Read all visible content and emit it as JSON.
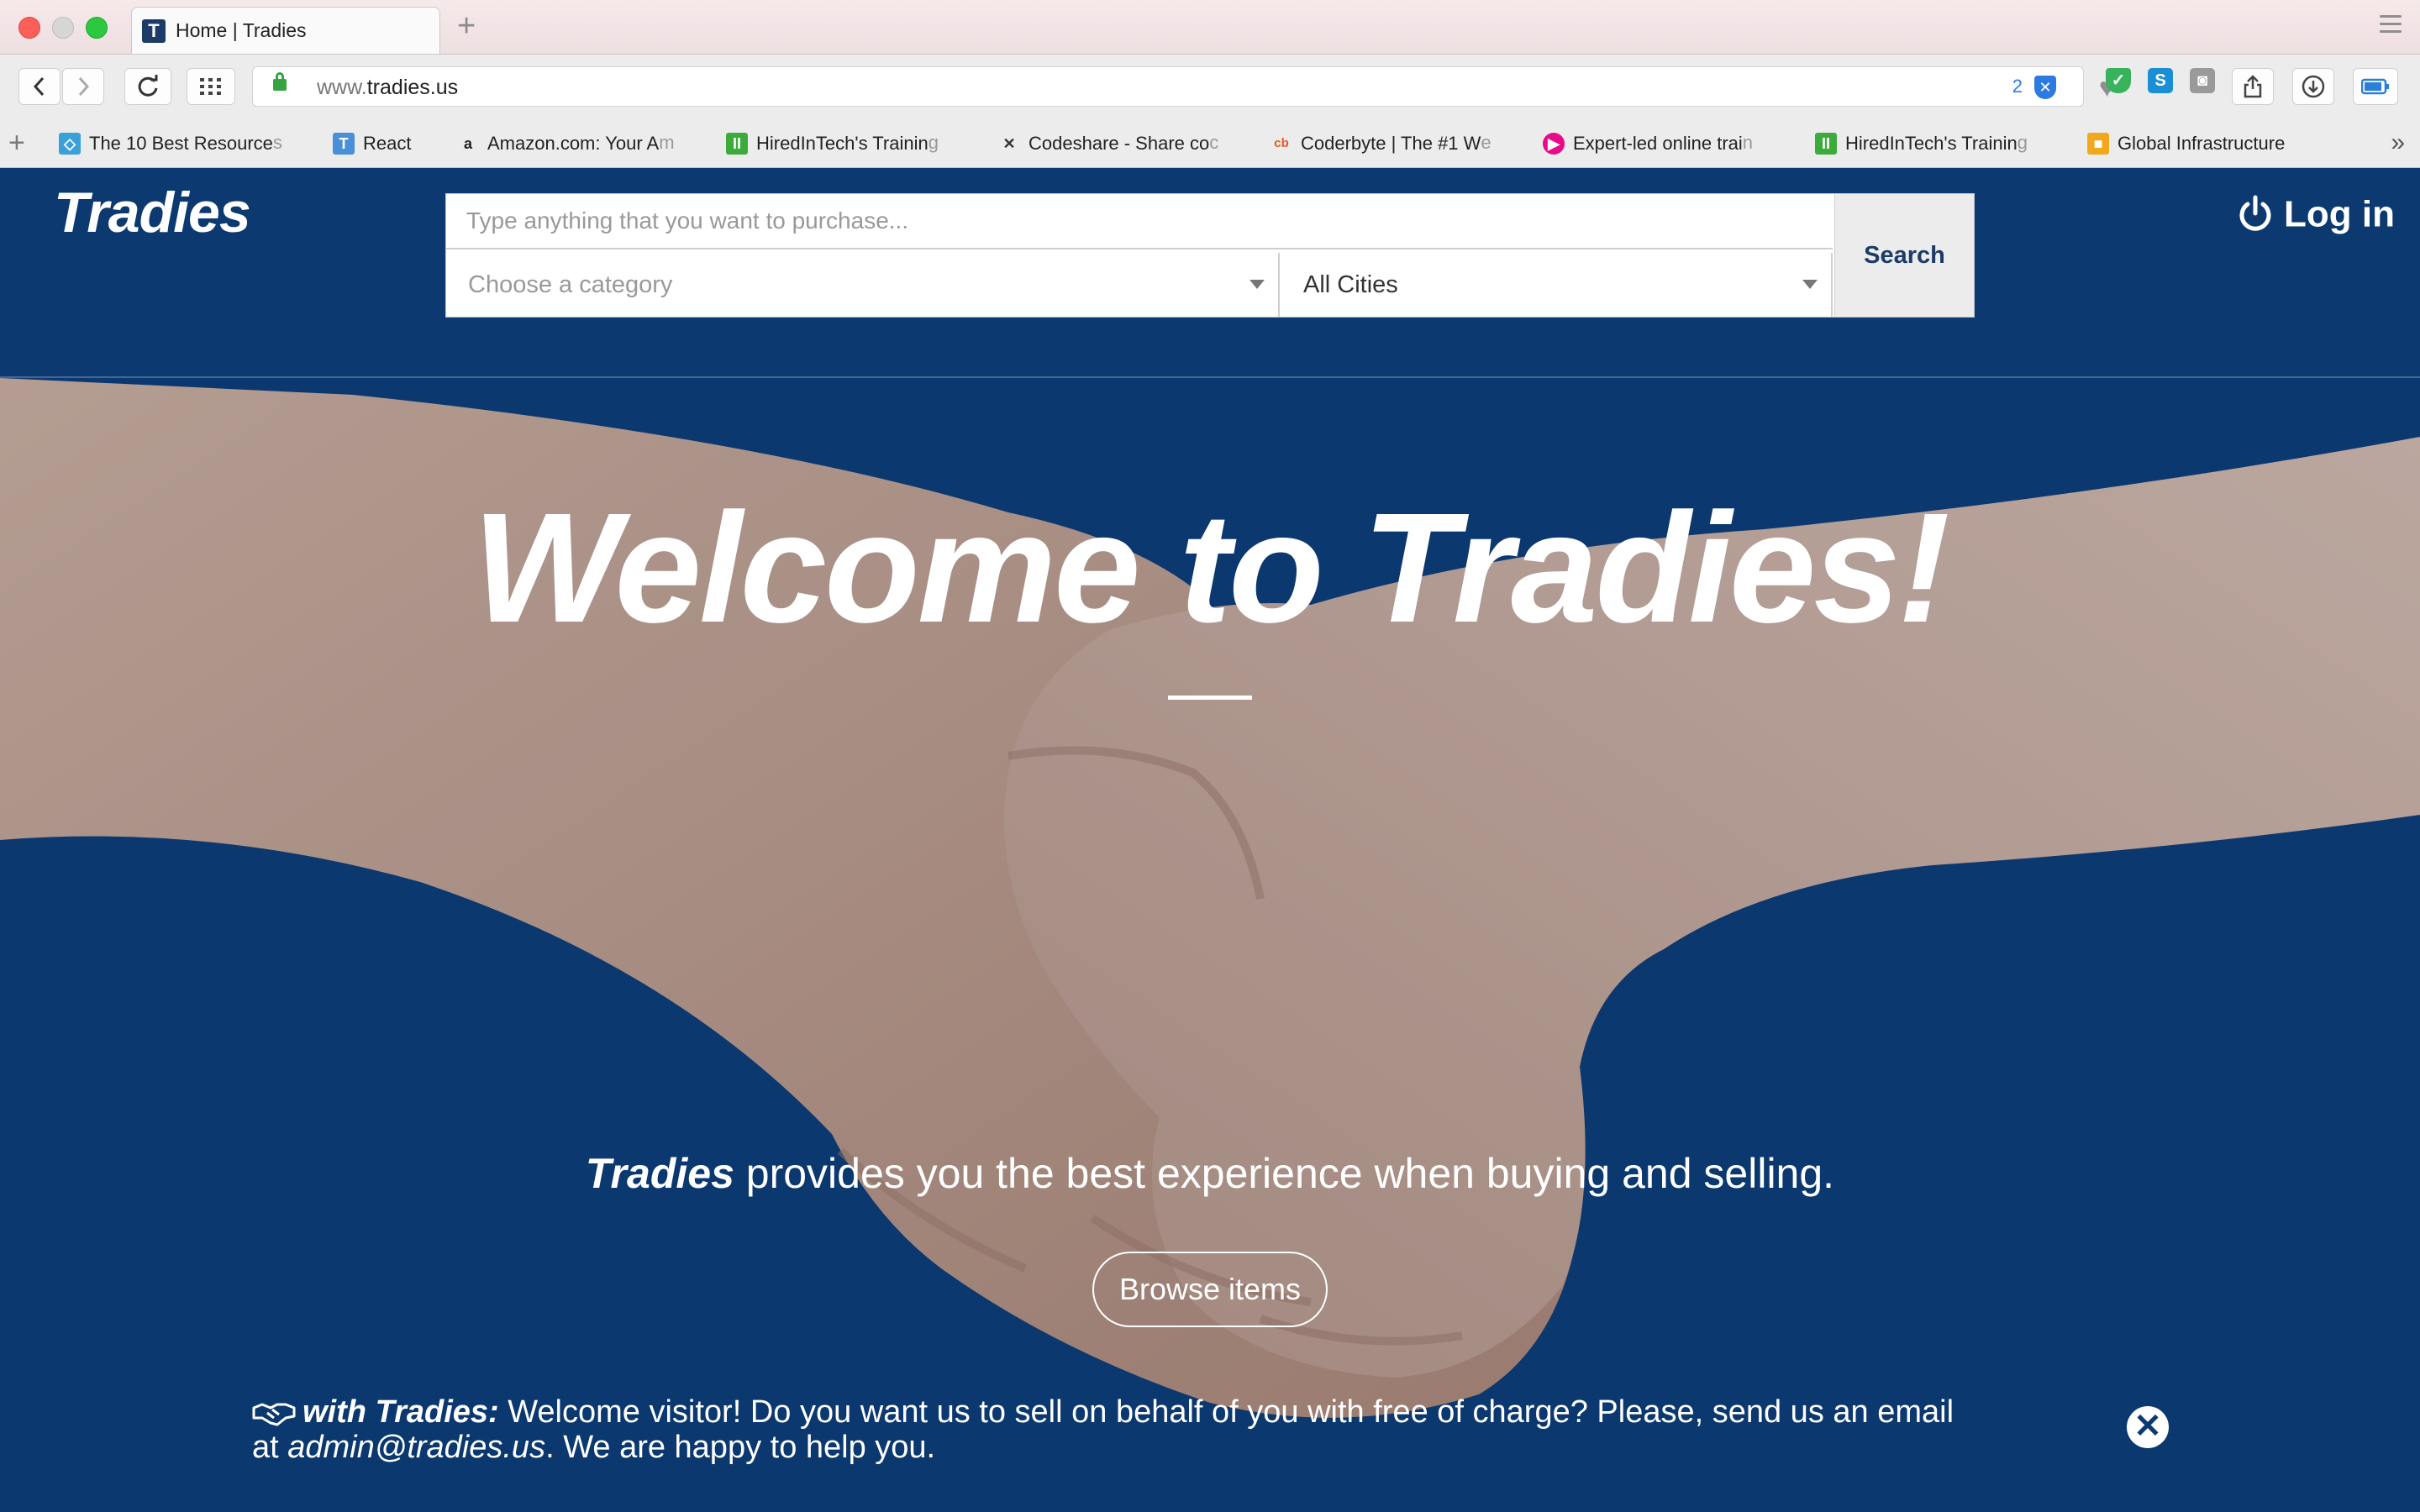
{
  "browser": {
    "tab_title": "Home | Tradies",
    "tab_favicon": "T",
    "url_prefix": "www.",
    "url_host": "tradies.us",
    "extension_badge_count": "2",
    "bookmarks": [
      {
        "label": "The 10 Best Resource",
        "fade": "s",
        "icon": "cube-icon",
        "color": "#3aa0d8"
      },
      {
        "label": "React",
        "fade": "",
        "icon": "t-icon",
        "color": "#4a90d9"
      },
      {
        "label": "Amazon.com: Your A",
        "fade": "m",
        "icon": "amazon-icon",
        "color": "#222222"
      },
      {
        "label": "HiredInTech's Trainin",
        "fade": "g",
        "icon": "hiredintech-icon",
        "color": "#3cab3c"
      },
      {
        "label": "Codeshare - Share co",
        "fade": "c",
        "icon": "codeshare-icon",
        "color": "#333333"
      },
      {
        "label": "Coderbyte | The #1 W",
        "fade": "e",
        "icon": "coderbyte-icon",
        "color": "#e15b26"
      },
      {
        "label": "Expert-led online trai",
        "fade": "n",
        "icon": "pluralsight-icon",
        "color": "#e80a89"
      },
      {
        "label": "HiredInTech's Trainin",
        "fade": "g",
        "icon": "hiredintech-icon",
        "color": "#3cab3c"
      },
      {
        "label": "Global Infrastructure",
        "fade": "",
        "icon": "aws-box-icon",
        "color": "#f2a81d"
      }
    ]
  },
  "header": {
    "logo": "Tradies",
    "login_label": "Log in"
  },
  "search": {
    "placeholder": "Type anything that you want to purchase...",
    "category_placeholder": "Choose a category",
    "city_value": "All Cities",
    "button_label": "Search"
  },
  "hero": {
    "title": "Welcome to Tradies!",
    "tagline_brand": "Tradies",
    "tagline_rest": " provides you the best experience when buying and selling.",
    "browse_label": "Browse items"
  },
  "notice": {
    "lead": "with Tradies:",
    "text1": " Welcome visitor! Do you want us to sell on behalf of you with free of charge? Please, send us an email at ",
    "email": "admin@tradies.us",
    "text2": ". We are happy to help you."
  },
  "colors": {
    "brand_navy": "#0c3970",
    "button_text": "#1d3b67"
  }
}
